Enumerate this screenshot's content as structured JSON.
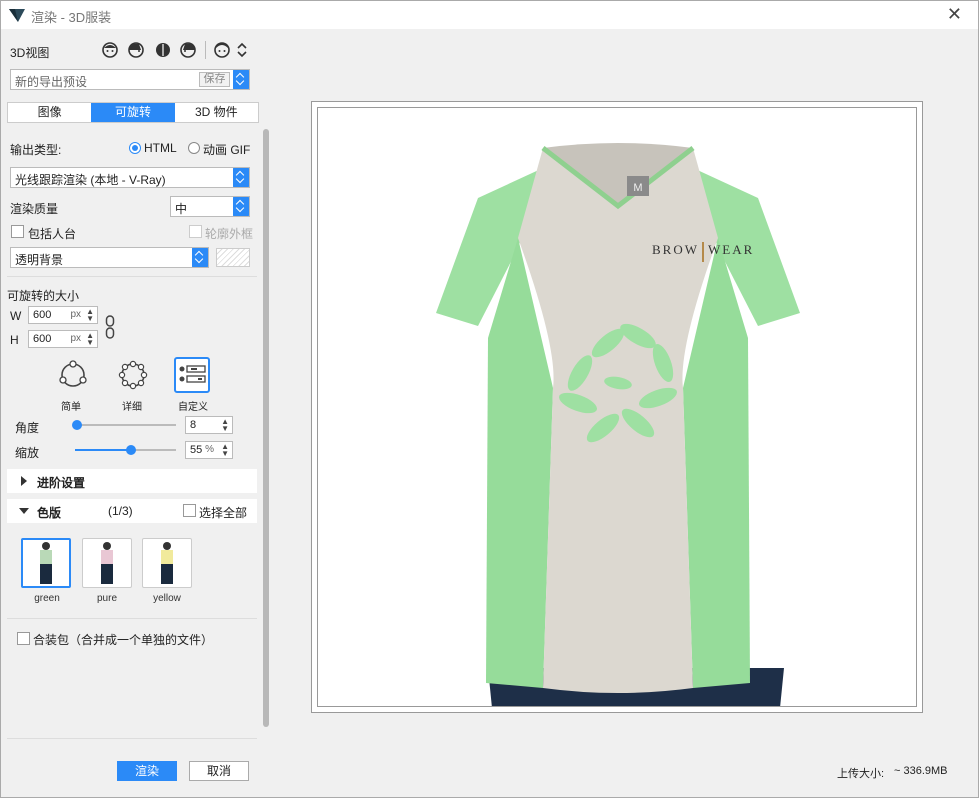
{
  "window": {
    "title": "渲染 - 3D服装"
  },
  "view3d": {
    "label": "3D视图"
  },
  "preset": {
    "value": "新的导出预设",
    "save_label": "保存"
  },
  "tabs": [
    {
      "label": "图像",
      "active": false
    },
    {
      "label": "可旋转",
      "active": true
    },
    {
      "label": "3D 物件",
      "active": false
    }
  ],
  "output": {
    "type_label": "输出类型:",
    "opt_html": "HTML",
    "opt_gif": "动画 GIF",
    "renderer": "光线跟踪渲染 (本地 - V-Ray)",
    "quality_label": "渲染质量",
    "quality_value": "中",
    "include_avatar": "包括人台",
    "outline": "轮廓外框",
    "background": "透明背景"
  },
  "size": {
    "label": "可旋转的大小",
    "w_label": "W",
    "w_value": "600",
    "h_label": "H",
    "h_value": "600",
    "unit": "px"
  },
  "presets": [
    {
      "label": "简单"
    },
    {
      "label": "详细"
    },
    {
      "label": "自定义"
    }
  ],
  "angle": {
    "label": "角度",
    "value": "8",
    "level": 0.0
  },
  "zoom": {
    "label": "缩放",
    "value": "55",
    "unit": "%",
    "level": 0.55
  },
  "advanced": {
    "label": "进阶设置"
  },
  "colorways": {
    "label": "色版",
    "count": "(1/3)",
    "select_all": "选择全部",
    "items": [
      {
        "label": "green",
        "color": "#b9d9b7"
      },
      {
        "label": "pure",
        "color": "#e9c7d4"
      },
      {
        "label": "yellow",
        "color": "#f1ea9c"
      }
    ]
  },
  "bundle": {
    "label": "合装包（合并成一个单独的文件）"
  },
  "actions": {
    "render": "渲染",
    "cancel": "取消"
  },
  "upload": {
    "label": "上传大小:",
    "value": "~ 336.9MB"
  },
  "preview": {
    "brand_text": "BROW",
    "brand_text2": "WEAR",
    "size_tag": "M"
  },
  "colors": {
    "accent": "#2b8af7",
    "shirt_body": "#dcd8d0",
    "shirt_side": "#96dc9a"
  }
}
